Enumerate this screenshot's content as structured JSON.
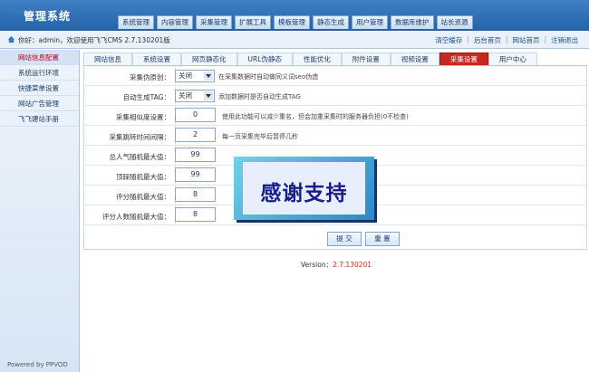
{
  "app_title": "管理系统",
  "top_nav": [
    "系统管理",
    "内容管理",
    "采集管理",
    "扩展工具",
    "模板管理",
    "静态生成",
    "用户管理",
    "数据库维护",
    "站长资源"
  ],
  "welcome_text": "你好：admin，欢迎使用飞飞CMS 2.7.130201版",
  "quick_links": [
    "清空缓存",
    "后台首页",
    "网站首页",
    "注销退出"
  ],
  "sidebar": {
    "items": [
      "网站信息配置",
      "系统运行环境",
      "快捷菜单设置",
      "网站广告管理",
      "飞飞建站手册"
    ],
    "active_index": 0,
    "powered_by": "Powered by PPVOD"
  },
  "content_tabs": {
    "items": [
      "网站信息",
      "系统设置",
      "网页静态化",
      "URL伪静态",
      "性能优化",
      "附件设置",
      "视频设置",
      "采集设置",
      "用户中心"
    ],
    "active_index": 7
  },
  "form": {
    "rows": [
      {
        "label": "采集伪原创：",
        "type": "select",
        "value": "关闭",
        "note": "在采集数据时自动做同义词seo伪造"
      },
      {
        "label": "自动生成TAG：",
        "type": "select",
        "value": "关闭",
        "note": "添加数据时是否自动生成TAG"
      },
      {
        "label": "采集相似度设置：",
        "type": "input",
        "value": "0",
        "note": "使用此功能可以减少重名，但会加重采集时的服务器负担(0不检查)"
      },
      {
        "label": "采集跳转时间间隔：",
        "type": "input",
        "value": "2",
        "note": "每一页采集完毕后暂停几秒"
      },
      {
        "label": "总人气随机最大值：",
        "type": "input",
        "value": "99",
        "note": ""
      },
      {
        "label": "顶踩随机最大值：",
        "type": "input",
        "value": "99",
        "note": ""
      },
      {
        "label": "评分随机最大值：",
        "type": "input",
        "value": "8",
        "note": ""
      },
      {
        "label": "评分人数随机最大值：",
        "type": "input",
        "value": "8",
        "note": ""
      }
    ],
    "submit_label": "提 交",
    "reset_label": "重 置"
  },
  "version_label": "Version：",
  "version_value": "2.7.130201",
  "overlay_text": "感谢支持",
  "colors": {
    "header": "#2e6db4",
    "active_tab": "#c8281e",
    "sidebar_active_text": "#b3001b",
    "overlay_text": "#1a1e8c"
  }
}
